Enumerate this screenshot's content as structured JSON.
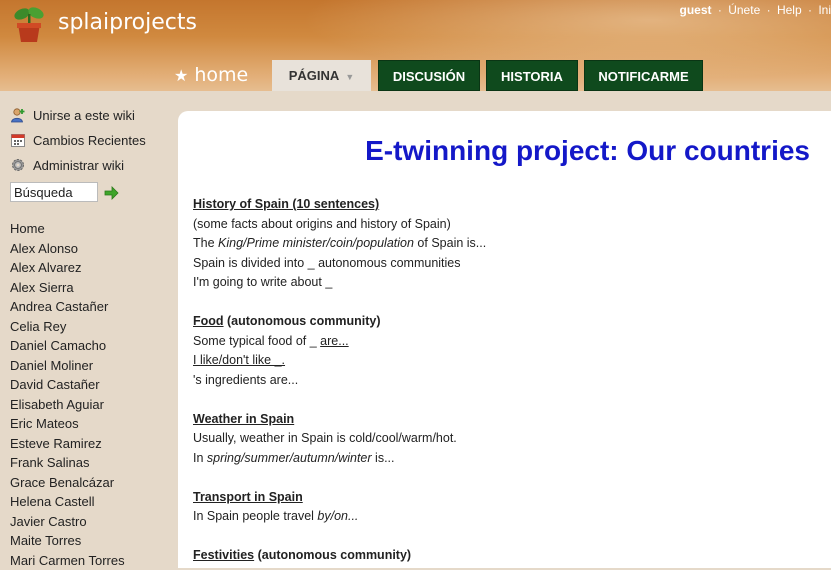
{
  "site": {
    "title": "splaiprojects"
  },
  "userbar": {
    "user": "guest",
    "sep": "·",
    "join": "Únete",
    "help": "Help",
    "login": "Ini"
  },
  "nav": {
    "home": "home",
    "tabs": {
      "pagina": "PÁGINA",
      "discusion": "DISCUSIÓN",
      "historia": "HISTORIA",
      "notificarme": "NOTIFICARME"
    }
  },
  "sidebar": {
    "join_wiki": "Unirse a este wiki",
    "recent_changes": "Cambios Recientes",
    "manage_wiki": "Administrar wiki",
    "search_value": "Búsqueda",
    "pages": [
      "Home",
      "Alex Alonso",
      "Alex Alvarez",
      "Alex Sierra",
      "Andrea Castañer",
      "Celia Rey",
      "Daniel Camacho",
      "Daniel Moliner",
      "David Castañer",
      "Elisabeth Aguiar",
      "Eric Mateos",
      "Esteve Ramirez",
      "Frank Salinas",
      "Grace Benalcázar",
      "Helena Castell",
      "Javier Castro",
      "Maite Torres",
      "Mari Carmen Torres"
    ]
  },
  "page": {
    "title": "E-twinning project: Our countries",
    "history": {
      "heading": "History of Spain (10 sentences)",
      "l1": "(some facts about origins and history of Spain)",
      "l2a": "The ",
      "l2b": "King/Prime minister/coin/population",
      "l2c": " of Spain is...",
      "l3": "Spain is divided into _ autonomous communities",
      "l4": "I'm going to write about _"
    },
    "food": {
      "heading": "Food",
      "heading_rest": " (autonomous community)",
      "l1a": "Some typical food of _ ",
      "l1b": "are...",
      "l2": "I like/don't like _.",
      "l3": "'s ingredients are..."
    },
    "weather": {
      "heading": "Weather in Spain",
      "l1": "Usually, weather in Spain is cold/cool/warm/hot.",
      "l2a": "In ",
      "l2b": "spring/summer/autumn/winter",
      "l2c": " is..."
    },
    "transport": {
      "heading": "Transport in Spain",
      "l1a": "In Spain people travel ",
      "l1b": "by/on..."
    },
    "festivities": {
      "heading": "Festivities",
      "heading_rest": " (autonomous community)"
    }
  }
}
